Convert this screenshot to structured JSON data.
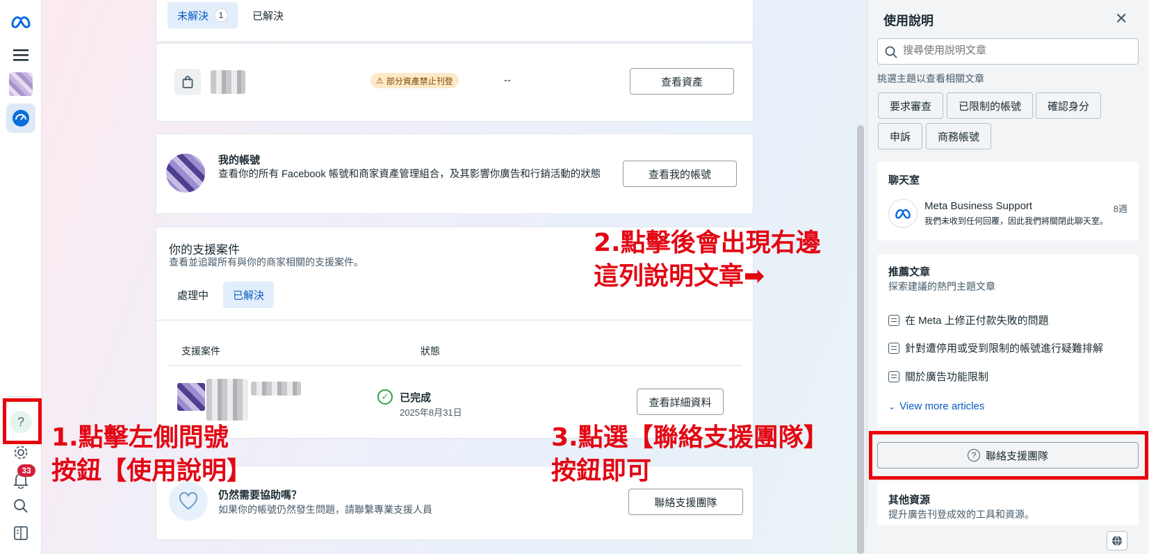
{
  "rail": {
    "notification_count": "33"
  },
  "top_tabs": {
    "unresolved_label": "未解決",
    "unresolved_count": "1",
    "resolved_label": "已解決"
  },
  "asset_row": {
    "warning": "部分資產禁止刊登",
    "dash": "--",
    "view_button": "查看資產"
  },
  "my_account": {
    "title": "我的帳號",
    "description": "查看你的所有 Facebook 帳號和商家資產管理組合，及其影響你廣告和行銷活動的狀態",
    "button": "查看我的帳號"
  },
  "support_cases": {
    "title": "你的支援案件",
    "subtitle": "查看並追蹤所有與你的商家相關的支援案件。",
    "tabs": [
      "處理中",
      "已解決"
    ],
    "col_case": "支援案件",
    "col_status": "狀態",
    "row": {
      "status": "已完成",
      "date": "2025年8月31日",
      "button": "查看詳細資料"
    }
  },
  "need_help": {
    "title": "仍然需要協助嗎？",
    "description": "如果你的帳號仍然發生問題，請聯繫專業支援人員",
    "button": "聯絡支援團隊"
  },
  "help_panel": {
    "title": "使用說明",
    "search_placeholder": "搜尋使用說明文章",
    "topics_hint": "挑選主題以查看相關文章",
    "topics": [
      "要求審查",
      "已限制的帳號",
      "確認身分",
      "申訴",
      "商務帳號"
    ],
    "chat": {
      "title": "聊天室",
      "name": "Meta Business Support",
      "time": "8週",
      "message": "我們未收到任何回覆，因此我們將關閉此聊天室。"
    },
    "recommended": {
      "title": "推薦文章",
      "subtitle": "探索建議的熱門主題文章",
      "articles": [
        "在 Meta 上修正付款失敗的問題",
        "針對遭停用或受到限制的帳號進行疑難排解",
        "關於廣告功能限制"
      ],
      "more": "View more articles"
    },
    "contact_button": "聯絡支援團隊",
    "other": {
      "title": "其他資源",
      "subtitle": "提升廣告刊登成效的工具和資源。"
    }
  },
  "annotations": {
    "step1": "1.點擊左側問號\n按鈕【使用說明】",
    "step2": "2.點擊後會出現右邊\n這列說明文章➡",
    "step3": "3.點選【聯絡支援團隊】\n按鈕即可"
  },
  "colors": {
    "annotation_red": "#e8000b",
    "accent_blue": "#0a5bbf",
    "success_green": "#31a24c"
  }
}
